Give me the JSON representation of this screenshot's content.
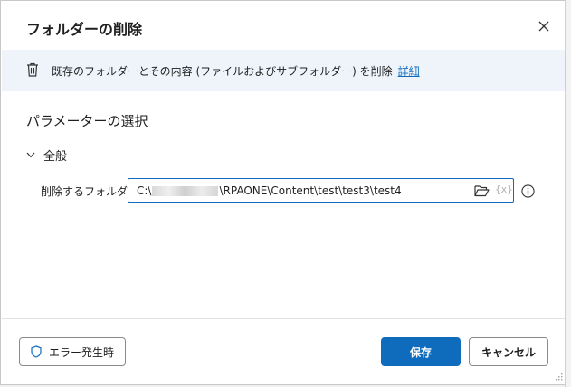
{
  "dialog": {
    "title": "フォルダーの削除",
    "close_label": "×"
  },
  "banner": {
    "icon": "trash-icon",
    "text": "既存のフォルダーとその内容 (ファイルおよびサブフォルダー) を削除",
    "link": "詳細"
  },
  "params": {
    "section_title": "パラメーターの選択",
    "group_label": "全般",
    "field_label": "削除するフォルダー:",
    "path_prefix": "C:\\",
    "path_suffix": "\\RPAONE\\Content\\test\\test3\\test4",
    "variable_button": "{x}"
  },
  "footer": {
    "error_button": "エラー発生時",
    "save_button": "保存",
    "cancel_button": "キャンセル"
  },
  "colors": {
    "accent": "#0f6cbd",
    "banner_bg": "#eff4fb"
  }
}
